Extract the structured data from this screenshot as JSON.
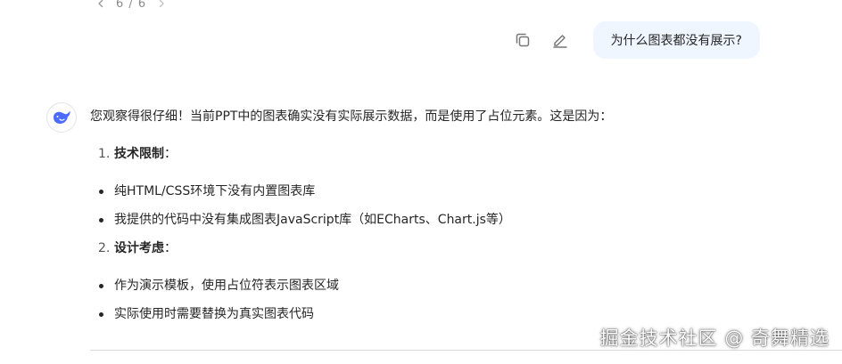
{
  "pager": {
    "label": "6 / 6"
  },
  "user_message": {
    "text": "为什么图表都没有展示?",
    "bubble_color": "#eff6ff"
  },
  "icons": {
    "copy": "copy-icon",
    "edit": "edit-icon",
    "avatar": "whale-avatar-icon",
    "prev": "chevron-left-icon",
    "next": "chevron-right-icon"
  },
  "answer": {
    "intro": "您观察得很仔细！当前PPT中的图表确实没有实际展示数据，而是使用了占位元素。这是因为：",
    "sections": [
      {
        "number": "1.",
        "title": "技术限制",
        "suffix": "：",
        "bullets": [
          "纯HTML/CSS环境下没有内置图表库",
          "我提供的代码中没有集成图表JavaScript库（如ECharts、Chart.js等）"
        ]
      },
      {
        "number": "2.",
        "title": "设计考虑",
        "suffix": "：",
        "bullets": [
          "作为演示模板，使用占位符表示图表区域",
          "实际使用时需要替换为真实图表代码"
        ]
      }
    ]
  },
  "watermark": {
    "text": "掘金技术社区 @ 奇舞精选"
  },
  "colors": {
    "accent": "#4d6bfe"
  }
}
